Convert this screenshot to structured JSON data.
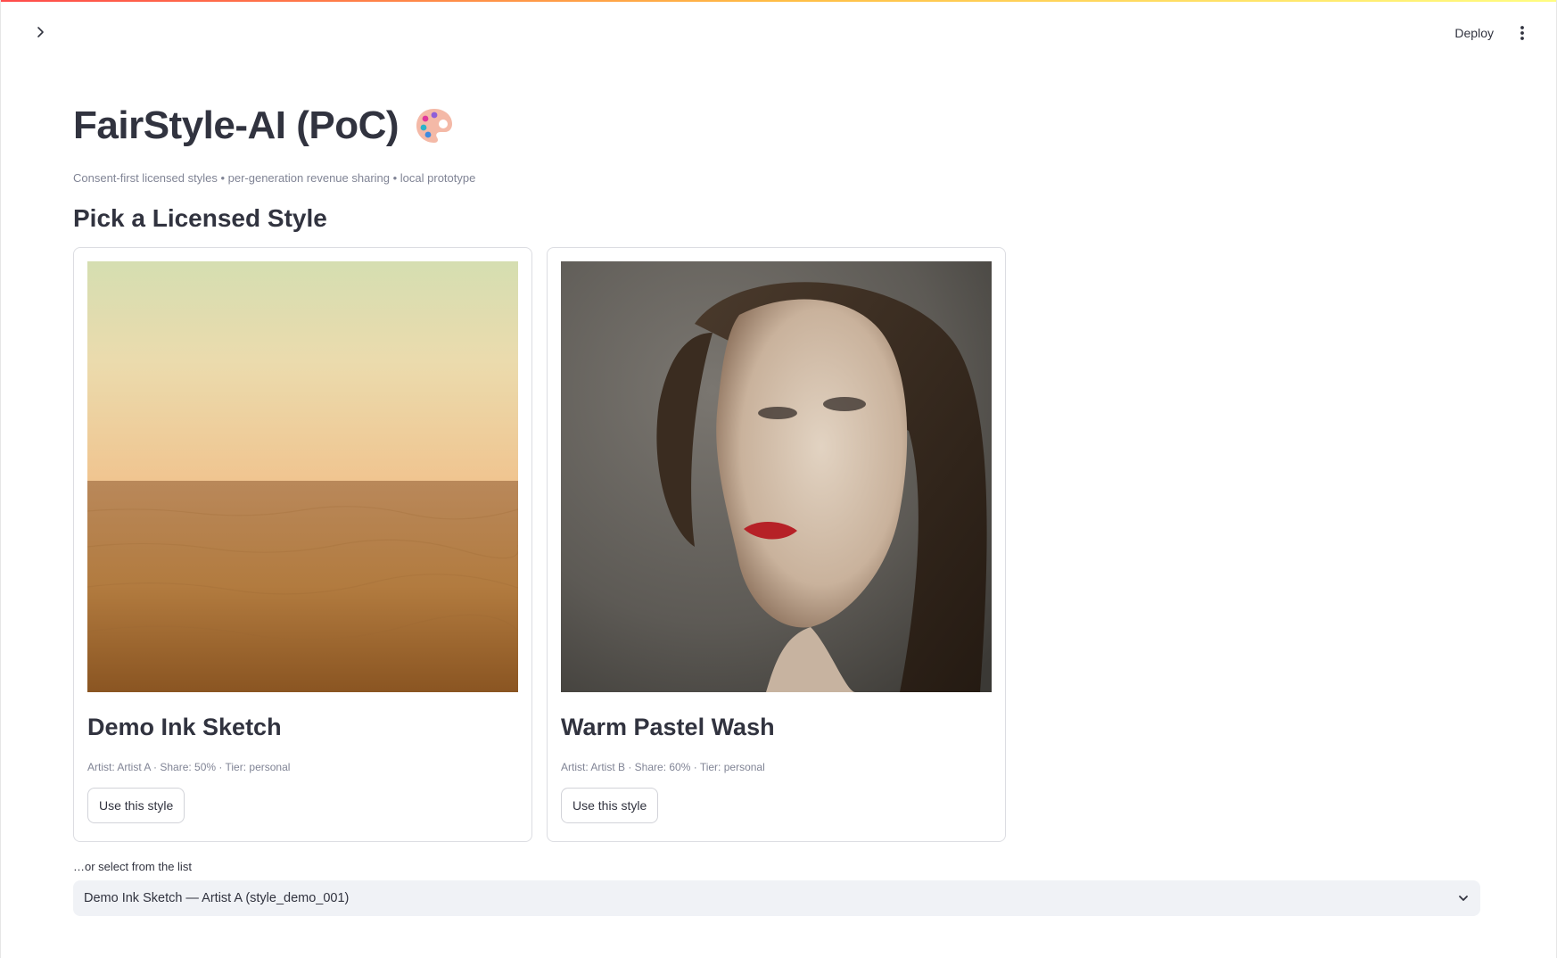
{
  "header": {
    "sidebar_toggle_icon": "chevron-right-icon",
    "deploy_label": "Deploy",
    "menu_icon": "vertical-ellipsis-icon"
  },
  "page": {
    "title": "FairStyle-AI (PoC)",
    "title_icon": "artist-palette-icon",
    "caption": "Consent-first licensed styles • per-generation revenue sharing • local prototype",
    "subheader": "Pick a Licensed Style"
  },
  "styles": [
    {
      "name": "Demo Ink Sketch",
      "image": "desert-dunes-photo",
      "meta": "Artist: Artist A · Share: 50% · Tier: personal",
      "button_label": "Use this style"
    },
    {
      "name": "Warm Pastel Wash",
      "image": "woman-portrait-photo",
      "meta": "Artist: Artist B · Share: 60% · Tier: personal",
      "button_label": "Use this style"
    }
  ],
  "select": {
    "label": "…or select from the list",
    "value": "Demo Ink Sketch — Artist A (style_demo_001)",
    "icon": "chevron-down-icon"
  },
  "colors": {
    "text": "#31333f",
    "muted": "#808495",
    "border": "#dcdde2",
    "select_bg": "#f0f2f6"
  }
}
